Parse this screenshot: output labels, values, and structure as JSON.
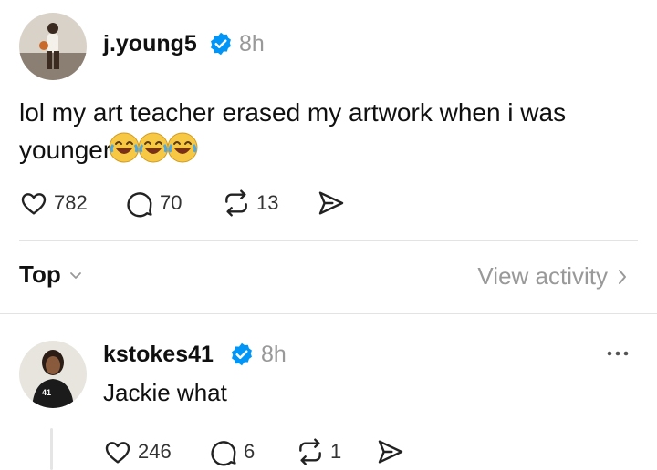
{
  "colors": {
    "text": "#101010",
    "muted": "#999999",
    "verified": "#0095f6",
    "divider": "#e3e3e3"
  },
  "post": {
    "username": "j.young5",
    "timestamp": "8h",
    "text": "lol my art teacher erased my artwork when i was younger",
    "emoji": "😂😂😂",
    "likes": "782",
    "comments": "70",
    "reposts": "13"
  },
  "sort": {
    "label": "Top",
    "view_activity": "View activity"
  },
  "reply": {
    "username": "kstokes41",
    "timestamp": "8h",
    "text": "Jackie what",
    "likes": "246",
    "comments": "6",
    "reposts": "1"
  },
  "icons": [
    "heart-icon",
    "comment-icon",
    "repost-icon",
    "share-icon",
    "verified-icon",
    "chevron-down-icon",
    "chevron-right-icon",
    "more-icon"
  ]
}
